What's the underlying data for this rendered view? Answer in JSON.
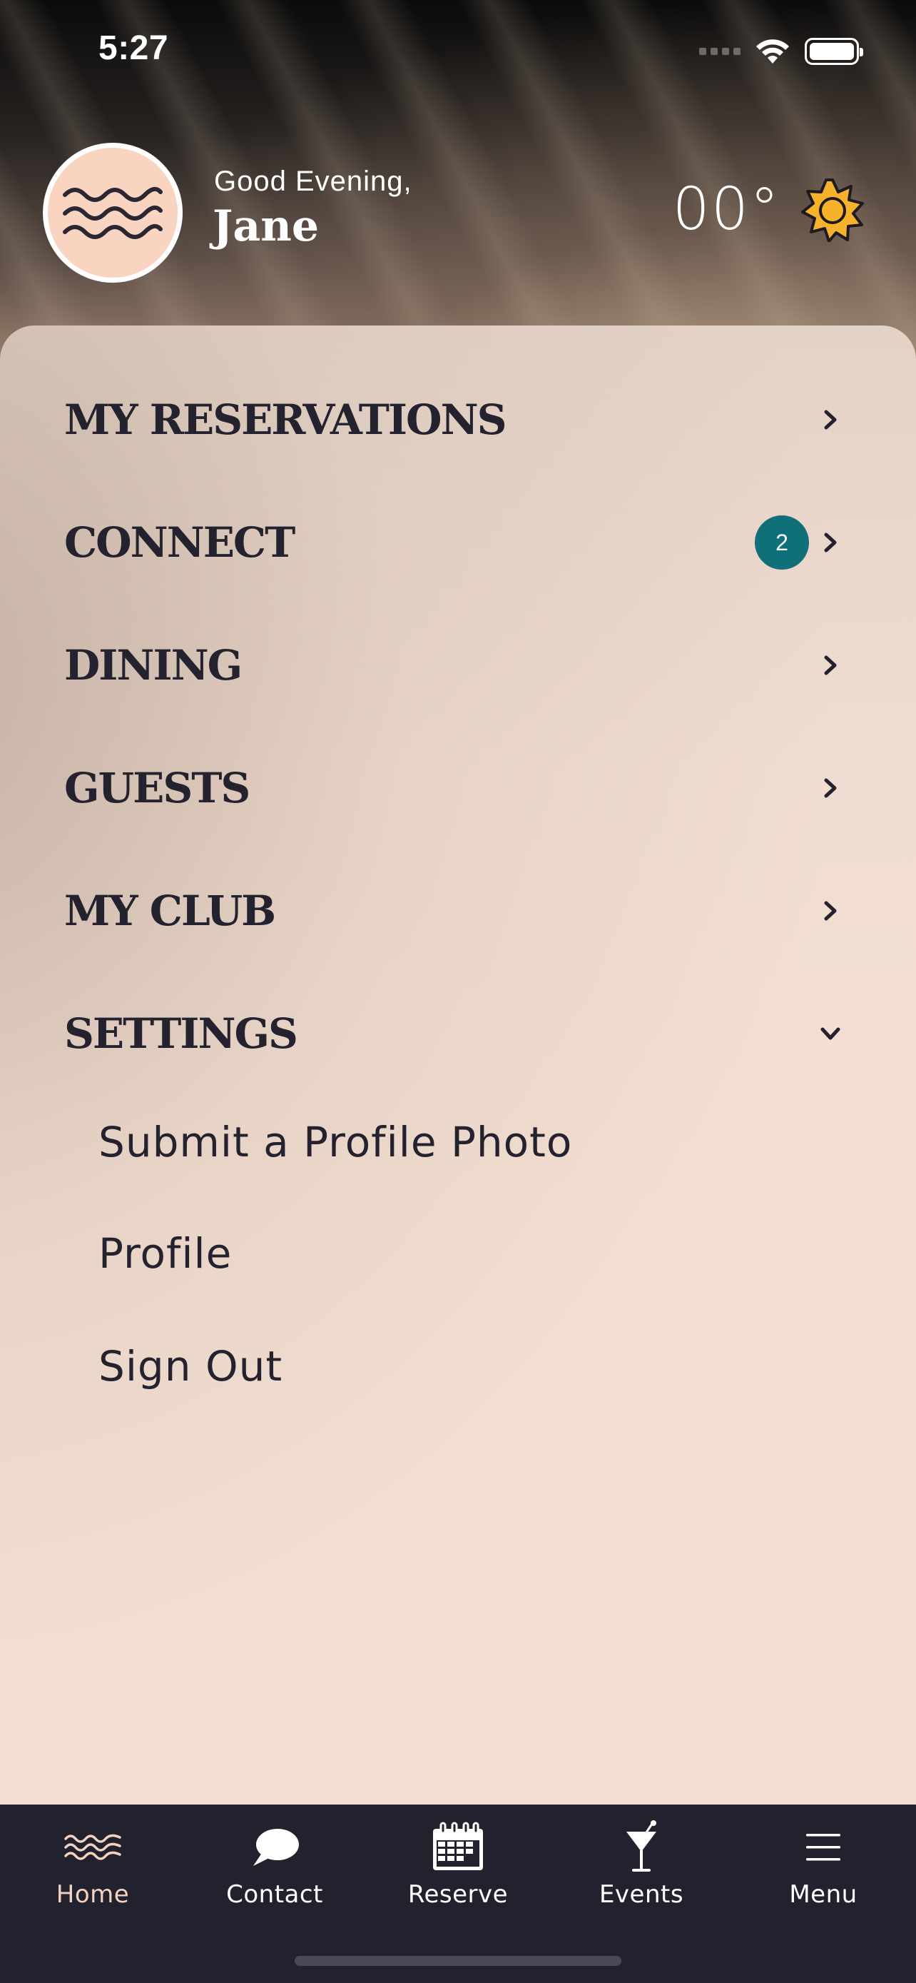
{
  "status_bar": {
    "time": "5:27",
    "icons": [
      "signal-icon",
      "wifi-icon",
      "battery-icon"
    ]
  },
  "header": {
    "greeting": "Good Evening,",
    "name": "Jane",
    "temperature": "00°",
    "weather_icon": "sun-icon",
    "avatar_icon": "waves-icon"
  },
  "menu": {
    "items": [
      {
        "label": "MY RESERVATIONS"
      },
      {
        "label": "CONNECT",
        "badge": "2"
      },
      {
        "label": "DINING"
      },
      {
        "label": "GUESTS"
      },
      {
        "label": "MY CLUB"
      },
      {
        "label": "SETTINGS",
        "expanded": true
      }
    ],
    "settings_sub_items": [
      {
        "label": "Submit a Profile Photo"
      },
      {
        "label": "Profile"
      },
      {
        "label": "Sign Out"
      }
    ]
  },
  "tab_bar": {
    "tabs": [
      {
        "label": "Home",
        "icon": "waves-icon",
        "active": true
      },
      {
        "label": "Contact",
        "icon": "chat-bubble-icon"
      },
      {
        "label": "Reserve",
        "icon": "calendar-icon"
      },
      {
        "label": "Events",
        "icon": "cocktail-icon"
      },
      {
        "label": "Menu",
        "icon": "hamburger-icon"
      }
    ]
  },
  "colors": {
    "panel": "#f3dfd2",
    "text_dark": "#23222e",
    "badge": "#10707a",
    "tab_bar": "#22222f",
    "tab_active": "#f3d2c0",
    "sun": "#f5b22a"
  }
}
